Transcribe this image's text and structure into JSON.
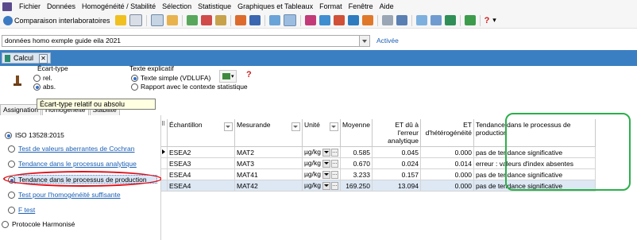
{
  "menu": [
    "Fichier",
    "Données",
    "Homogénéité / Stabilité",
    "Sélection",
    "Statistique",
    "Graphiques et Tableaux",
    "Format",
    "Fenêtre",
    "Aide"
  ],
  "toolbar": {
    "title": "Comparaison interlaboratoires"
  },
  "dataset": {
    "value": "données homo exmple guide eila 2021",
    "status": "Activée"
  },
  "doc_tab": {
    "label": "Calcul",
    "close": "✕"
  },
  "options": {
    "ecart_type": {
      "title": "Écart-type",
      "rel": "rel.",
      "abs": "abs."
    },
    "texte": {
      "title": "Texte explicatif",
      "simple": "Texte simple (VDLUFA)",
      "rapport": "Rapport avec le contexte statistique"
    },
    "help": "?"
  },
  "subtabs": {
    "assignation": "Assignation",
    "homogeneite": "Homogénéité",
    "stabilite": "Stabilité"
  },
  "tooltip": "Écart-type relatif ou absolu",
  "left_panel": {
    "iso": "ISO 13528:2015",
    "options": [
      "Test de valeurs aberrantes de Cochran",
      "Tendance dans le processus analytique",
      "Tendance dans le processus de production",
      "Test pour l'homogénéité suffisante",
      "F test"
    ],
    "protocole": "Protocole Harmonisé"
  },
  "table": {
    "headers": [
      "Échantillon",
      "Mesurande",
      "Unité",
      "Moyenne",
      "ET dû à l'erreur analytique",
      "ET d'hétérogénéité",
      "Tendance dans le processus de production"
    ],
    "rows": [
      [
        "ESEA2",
        "MAT2",
        "µg/kg",
        "0.585",
        "0.045",
        "0.000",
        "pas de tendance significative"
      ],
      [
        "ESEA3",
        "MAT3",
        "µg/kg",
        "0.670",
        "0.024",
        "0.014",
        "erreur : valeurs d'index absentes"
      ],
      [
        "ESEA4",
        "MAT41",
        "µg/kg",
        "3.233",
        "0.157",
        "0.000",
        "pas de tendance significative"
      ],
      [
        "ESEA4",
        "MAT42",
        "µg/kg",
        "169.250",
        "13.094",
        "0.000",
        "pas de tendance significative"
      ]
    ],
    "ellipsis": "…"
  },
  "colors": {
    "accent_blue": "#3a7fc2",
    "highlight_red": "#e0111b",
    "highlight_green": "#2bb04a",
    "link": "#1a5fb4"
  }
}
